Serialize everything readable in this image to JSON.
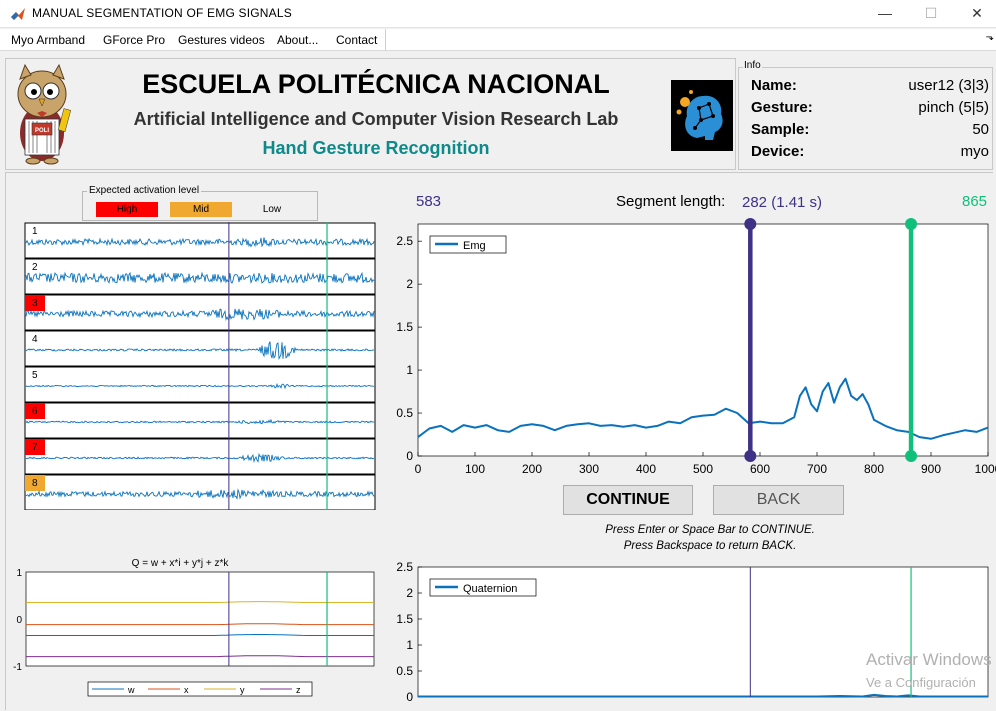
{
  "window": {
    "title": "MANUAL SEGMENTATION OF EMG SIGNALS",
    "minimize_glyph": "—",
    "maximize_glyph": "☐",
    "close_glyph": "✕"
  },
  "menu": {
    "items": [
      "Myo Armband",
      "GForce Pro",
      "Gestures videos",
      "About...",
      "Contact"
    ],
    "toolbar_arrow_glyph": "⬎"
  },
  "header": {
    "logo_badge": "POLI",
    "school": "ESCUELA POLITÉCNICA NACIONAL",
    "lab": "Artificial Intelligence and Computer Vision Research Lab",
    "subtitle": "Hand Gesture Recognition",
    "accent_color": "#0e8a8a"
  },
  "info": {
    "legend": "Info",
    "rows": [
      {
        "key": "Name:",
        "value": "user12 (3|3)"
      },
      {
        "key": "Gesture:",
        "value": "pinch (5|5)"
      },
      {
        "key": "Sample:",
        "value": "50"
      },
      {
        "key": "Device:",
        "value": "myo"
      }
    ]
  },
  "activation_legend": {
    "title": "Expected activation level",
    "levels": [
      {
        "label": "High",
        "color": "#ff0000"
      },
      {
        "label": "Mid",
        "color": "#f0a830"
      },
      {
        "label": "Low",
        "color": "none"
      }
    ]
  },
  "channels": [
    {
      "label": "1",
      "level": "low",
      "amp": 3,
      "bursts": [
        [
          0.62,
          0.72,
          2
        ]
      ]
    },
    {
      "label": "2",
      "level": "low",
      "amp": 5,
      "bursts": []
    },
    {
      "label": "3",
      "level": "high",
      "amp": 3,
      "bursts": [
        [
          0.5,
          0.75,
          3
        ]
      ]
    },
    {
      "label": "4",
      "level": "low",
      "amp": 1,
      "bursts": [
        [
          0.66,
          0.78,
          9
        ]
      ]
    },
    {
      "label": "5",
      "level": "low",
      "amp": 0.6,
      "bursts": [
        [
          0.7,
          0.76,
          2
        ]
      ]
    },
    {
      "label": "6",
      "level": "high",
      "amp": 0.8,
      "bursts": [
        [
          0.6,
          0.75,
          1.5
        ]
      ]
    },
    {
      "label": "7",
      "level": "high",
      "amp": 0.8,
      "bursts": [
        [
          0.6,
          0.75,
          3
        ]
      ]
    },
    {
      "label": "8",
      "level": "mid",
      "amp": 2.5,
      "bursts": [
        [
          0.45,
          0.75,
          2
        ]
      ]
    }
  ],
  "colors": {
    "signal": "#0a72bd",
    "start_marker": "#3e3186",
    "end_marker": "#10c07a",
    "level_high": "#ff0000",
    "level_mid": "#f0a830"
  },
  "segment": {
    "start": "583",
    "end": "865",
    "length_label": "Segment length:",
    "length_value": "282 (1.41 s)",
    "start_value": 583,
    "end_value": 865
  },
  "quaternion_mini": {
    "title": "Q = w + x*i + y*j + z*k",
    "yticks": [
      "1",
      "0",
      "-1"
    ],
    "legend": [
      "w",
      "x",
      "y",
      "z"
    ],
    "series": [
      {
        "name": "w",
        "value": -0.35,
        "color": "#0a72bd"
      },
      {
        "name": "x",
        "value": -0.12,
        "color": "#d95319"
      },
      {
        "name": "y",
        "value": 0.35,
        "color": "#d9b52a"
      },
      {
        "name": "z",
        "value": -0.8,
        "color": "#7e2f8e"
      }
    ]
  },
  "chart_data": [
    {
      "type": "line",
      "legend": [
        "Emg"
      ],
      "xlim": [
        0,
        1000
      ],
      "ylim": [
        0,
        2.7
      ],
      "xticks": [
        0,
        100,
        200,
        300,
        400,
        500,
        600,
        700,
        800,
        900,
        1000
      ],
      "yticks": [
        0,
        0.5,
        1,
        1.5,
        2,
        2.5
      ],
      "series": [
        {
          "name": "Emg",
          "x": [
            0,
            20,
            40,
            60,
            80,
            100,
            120,
            140,
            160,
            180,
            200,
            220,
            240,
            260,
            280,
            300,
            320,
            340,
            360,
            380,
            400,
            420,
            440,
            460,
            480,
            500,
            520,
            540,
            560,
            580,
            600,
            620,
            640,
            660,
            670,
            680,
            690,
            700,
            710,
            720,
            730,
            740,
            750,
            760,
            770,
            780,
            790,
            800,
            820,
            840,
            860,
            880,
            900,
            920,
            940,
            960,
            980,
            1000
          ],
          "y": [
            0.22,
            0.32,
            0.35,
            0.28,
            0.36,
            0.33,
            0.36,
            0.3,
            0.28,
            0.35,
            0.37,
            0.35,
            0.3,
            0.35,
            0.37,
            0.38,
            0.35,
            0.36,
            0.34,
            0.36,
            0.33,
            0.35,
            0.4,
            0.38,
            0.45,
            0.47,
            0.48,
            0.55,
            0.5,
            0.38,
            0.4,
            0.38,
            0.38,
            0.45,
            0.7,
            0.8,
            0.6,
            0.52,
            0.75,
            0.85,
            0.62,
            0.8,
            0.9,
            0.7,
            0.65,
            0.72,
            0.6,
            0.42,
            0.35,
            0.3,
            0.28,
            0.22,
            0.2,
            0.24,
            0.27,
            0.3,
            0.28,
            0.33
          ]
        }
      ]
    },
    {
      "type": "line",
      "legend": [
        "Quaternion"
      ],
      "xlim": [
        0,
        1000
      ],
      "ylim": [
        0,
        2.5
      ],
      "yticks": [
        0,
        0.5,
        1,
        1.5,
        2,
        2.5
      ],
      "series": [
        {
          "name": "Quaternion",
          "x": [
            0,
            650,
            700,
            740,
            780,
            800,
            820,
            840,
            860,
            880,
            1000
          ],
          "y": [
            0.01,
            0.01,
            0.01,
            0.02,
            0.01,
            0.04,
            0.02,
            0.01,
            0.03,
            0.01,
            0.01
          ]
        }
      ]
    }
  ],
  "buttons": {
    "continue": "CONTINUE",
    "back": "BACK"
  },
  "instructions": [
    "Press Enter or Space Bar to CONTINUE.",
    "Press Backspace to return BACK."
  ],
  "watermark": [
    "Activar Windows",
    "Ve a Configuración"
  ]
}
